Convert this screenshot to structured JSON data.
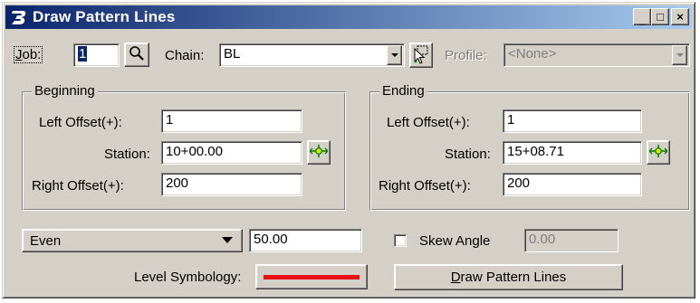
{
  "window": {
    "title": "Draw Pattern Lines",
    "minimize_glyph": "_",
    "restore_glyph": "□",
    "close_glyph": "×"
  },
  "top": {
    "job_label_u": "J",
    "job_label_rest": "ob:",
    "job_value": "1",
    "chain_label": "Chain:",
    "chain_value": "BL",
    "profile_label": "Profile:",
    "profile_value": "<None>"
  },
  "beginning": {
    "title": "Beginning",
    "left_offset_label": "Left Offset(+):",
    "left_offset_value": "1",
    "station_label": "Station:",
    "station_value": "10+00.00",
    "right_offset_label": "Right Offset(+):",
    "right_offset_value": "200"
  },
  "ending": {
    "title": "Ending",
    "left_offset_label": "Left Offset(+):",
    "left_offset_value": "1",
    "station_label": "Station:",
    "station_value": "15+08.71",
    "right_offset_label": "Right Offset(+):",
    "right_offset_value": "200"
  },
  "bottom": {
    "mode_value": "Even",
    "interval_value": "50.00",
    "skew_label": "Skew Angle",
    "skew_checked": false,
    "skew_value": "0.00",
    "level_symbology_label": "Level Symbology:",
    "level_symbology_color": "#e81010",
    "draw_button_u": "D",
    "draw_button_rest": "raw Pattern Lines"
  },
  "icons": {
    "app": "bentley-b-icon",
    "search": "magnifier-icon",
    "pick_chain": "cursor-pick-icon",
    "station_locate": "target-crosshair-icon"
  },
  "colors": {
    "title_gradient_start": "#0a246a",
    "title_gradient_end": "#a6caf0",
    "dialog_face": "#d4d0c8",
    "station_icon": "#008000"
  }
}
